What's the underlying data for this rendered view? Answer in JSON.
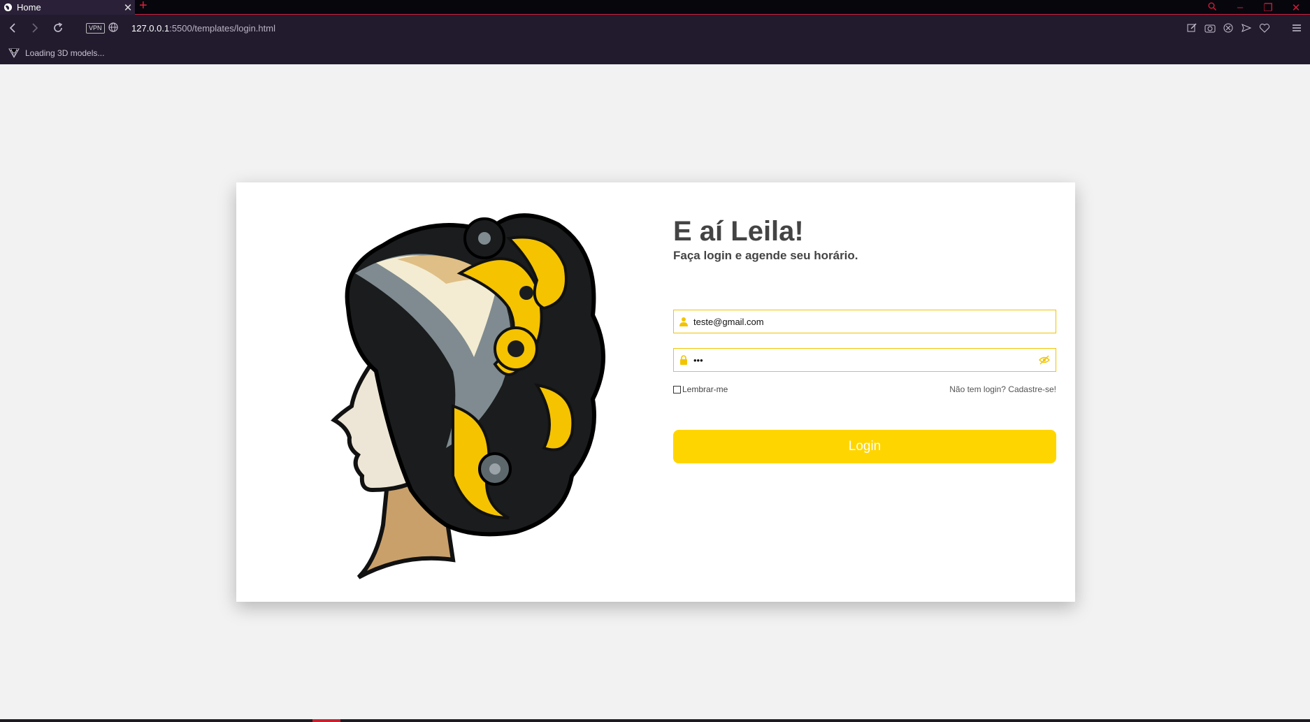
{
  "browser": {
    "tab": {
      "title": "Home"
    },
    "address_bar": {
      "host": "127.0.0.1",
      "path": ":5500/templates/login.html"
    },
    "vpn_label": "VPN",
    "status": "Loading 3D models..."
  },
  "login": {
    "greeting": "E aí Leila!",
    "subtitle": "Faça login e agende seu horário.",
    "email_value": "teste@gmail.com",
    "password_value": "•••",
    "remember_label": "Lembrar-me",
    "signup_link": "Não tem login? Cadastre-se!",
    "login_button": "Login"
  },
  "colors": {
    "accent": "#ffd500",
    "field_border": "#f2c400",
    "browser_bg": "#221b2e",
    "browser_accent": "#d21d38"
  }
}
